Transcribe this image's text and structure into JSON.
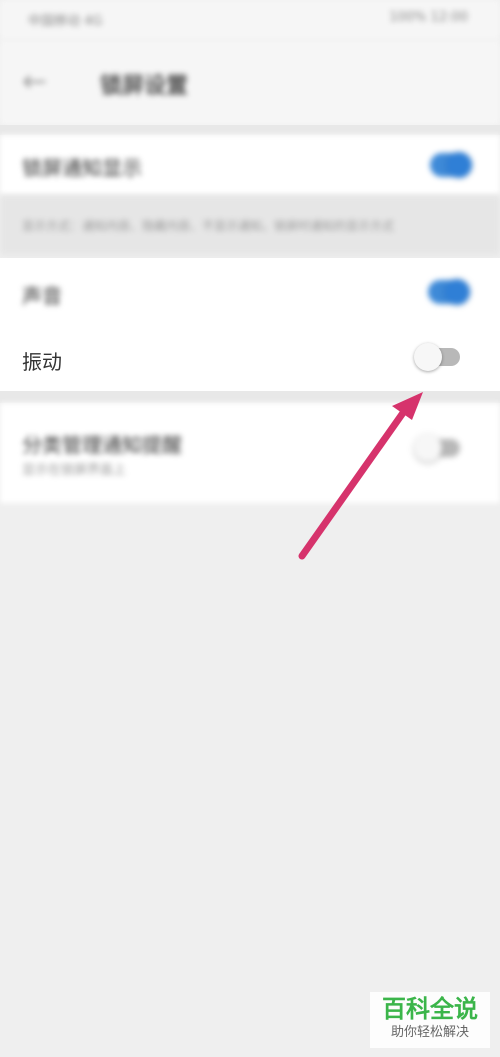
{
  "status_bar": {
    "left_text": "中国移动 4G",
    "right_text": "100% 12:00"
  },
  "header": {
    "back_glyph": "←",
    "title": "锁屏设置"
  },
  "rows": {
    "lock_screen_notify": {
      "label": "锁屏通知显示",
      "enabled": true
    },
    "description": "显示方式：通知内容、隐藏内容、不显示通知，锁屏时通知的显示方式",
    "sound": {
      "label": "声音",
      "enabled": true
    },
    "vibration": {
      "label": "振动",
      "enabled": false
    },
    "smart_reminder": {
      "label": "分类管理通知提醒",
      "sub": "显示在锁屏界面上",
      "enabled": false
    }
  },
  "watermark": {
    "main": "百科全说",
    "sub": "助你轻松解决"
  },
  "colors": {
    "toggle_on": "#3e8ad8",
    "arrow": "#d6336c",
    "watermark_green": "#3bb54a"
  }
}
